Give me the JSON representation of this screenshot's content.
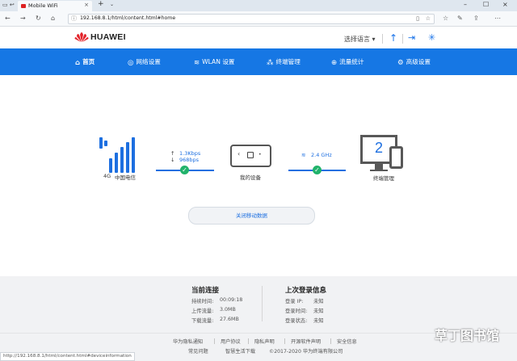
{
  "browser": {
    "tab_title": "Mobile WiFi",
    "url": "192.168.8.1/html/content.html#home",
    "status_url": "http://192.168.8.1/html/content.html#deviceinformation"
  },
  "header": {
    "brand": "HUAWEI",
    "language": "选择语言 ▾"
  },
  "menu": {
    "items": [
      {
        "label": "首页",
        "icon": "home-icon"
      },
      {
        "label": "网络设置",
        "icon": "globe-icon"
      },
      {
        "label": "WLAN 设置",
        "icon": "wifi-icon"
      },
      {
        "label": "终端管理",
        "icon": "devices-icon"
      },
      {
        "label": "流量统计",
        "icon": "traffic-icon"
      },
      {
        "label": "高级设置",
        "icon": "gear-icon"
      }
    ],
    "accent": "#1677e4"
  },
  "diagram": {
    "network": "4G",
    "operator": "中国电信",
    "upload_speed": "1.3Kbps",
    "download_speed": "968bps",
    "device_label": "我的设备",
    "band": "2.4 GHz",
    "terminal_label": "终端管理",
    "terminal_count": "2",
    "status_color": "#21b36b"
  },
  "mobile_data_button": "关闭移动数据",
  "current_connection": {
    "title": "当前连接",
    "rows": [
      {
        "label": "持续时间:",
        "value": "00:09:18"
      },
      {
        "label": "上传流量:",
        "value": "3.0MB"
      },
      {
        "label": "下载流量:",
        "value": "27.6MB"
      }
    ]
  },
  "last_login": {
    "title": "上次登录信息",
    "rows": [
      {
        "label": "登录 IP:",
        "value": "未知"
      },
      {
        "label": "登录时间:",
        "value": "未知"
      },
      {
        "label": "登录状态:",
        "value": "未知"
      }
    ]
  },
  "footer": {
    "links": [
      "华为隐私通知",
      "用户协议",
      "隐私声明",
      "开源软件声明",
      "安全信息"
    ],
    "links2": [
      "常见问题",
      "智慧生活下载"
    ],
    "copyright": "©2017-2020 华为终端有限公司"
  },
  "watermark": "草丁图书馆"
}
